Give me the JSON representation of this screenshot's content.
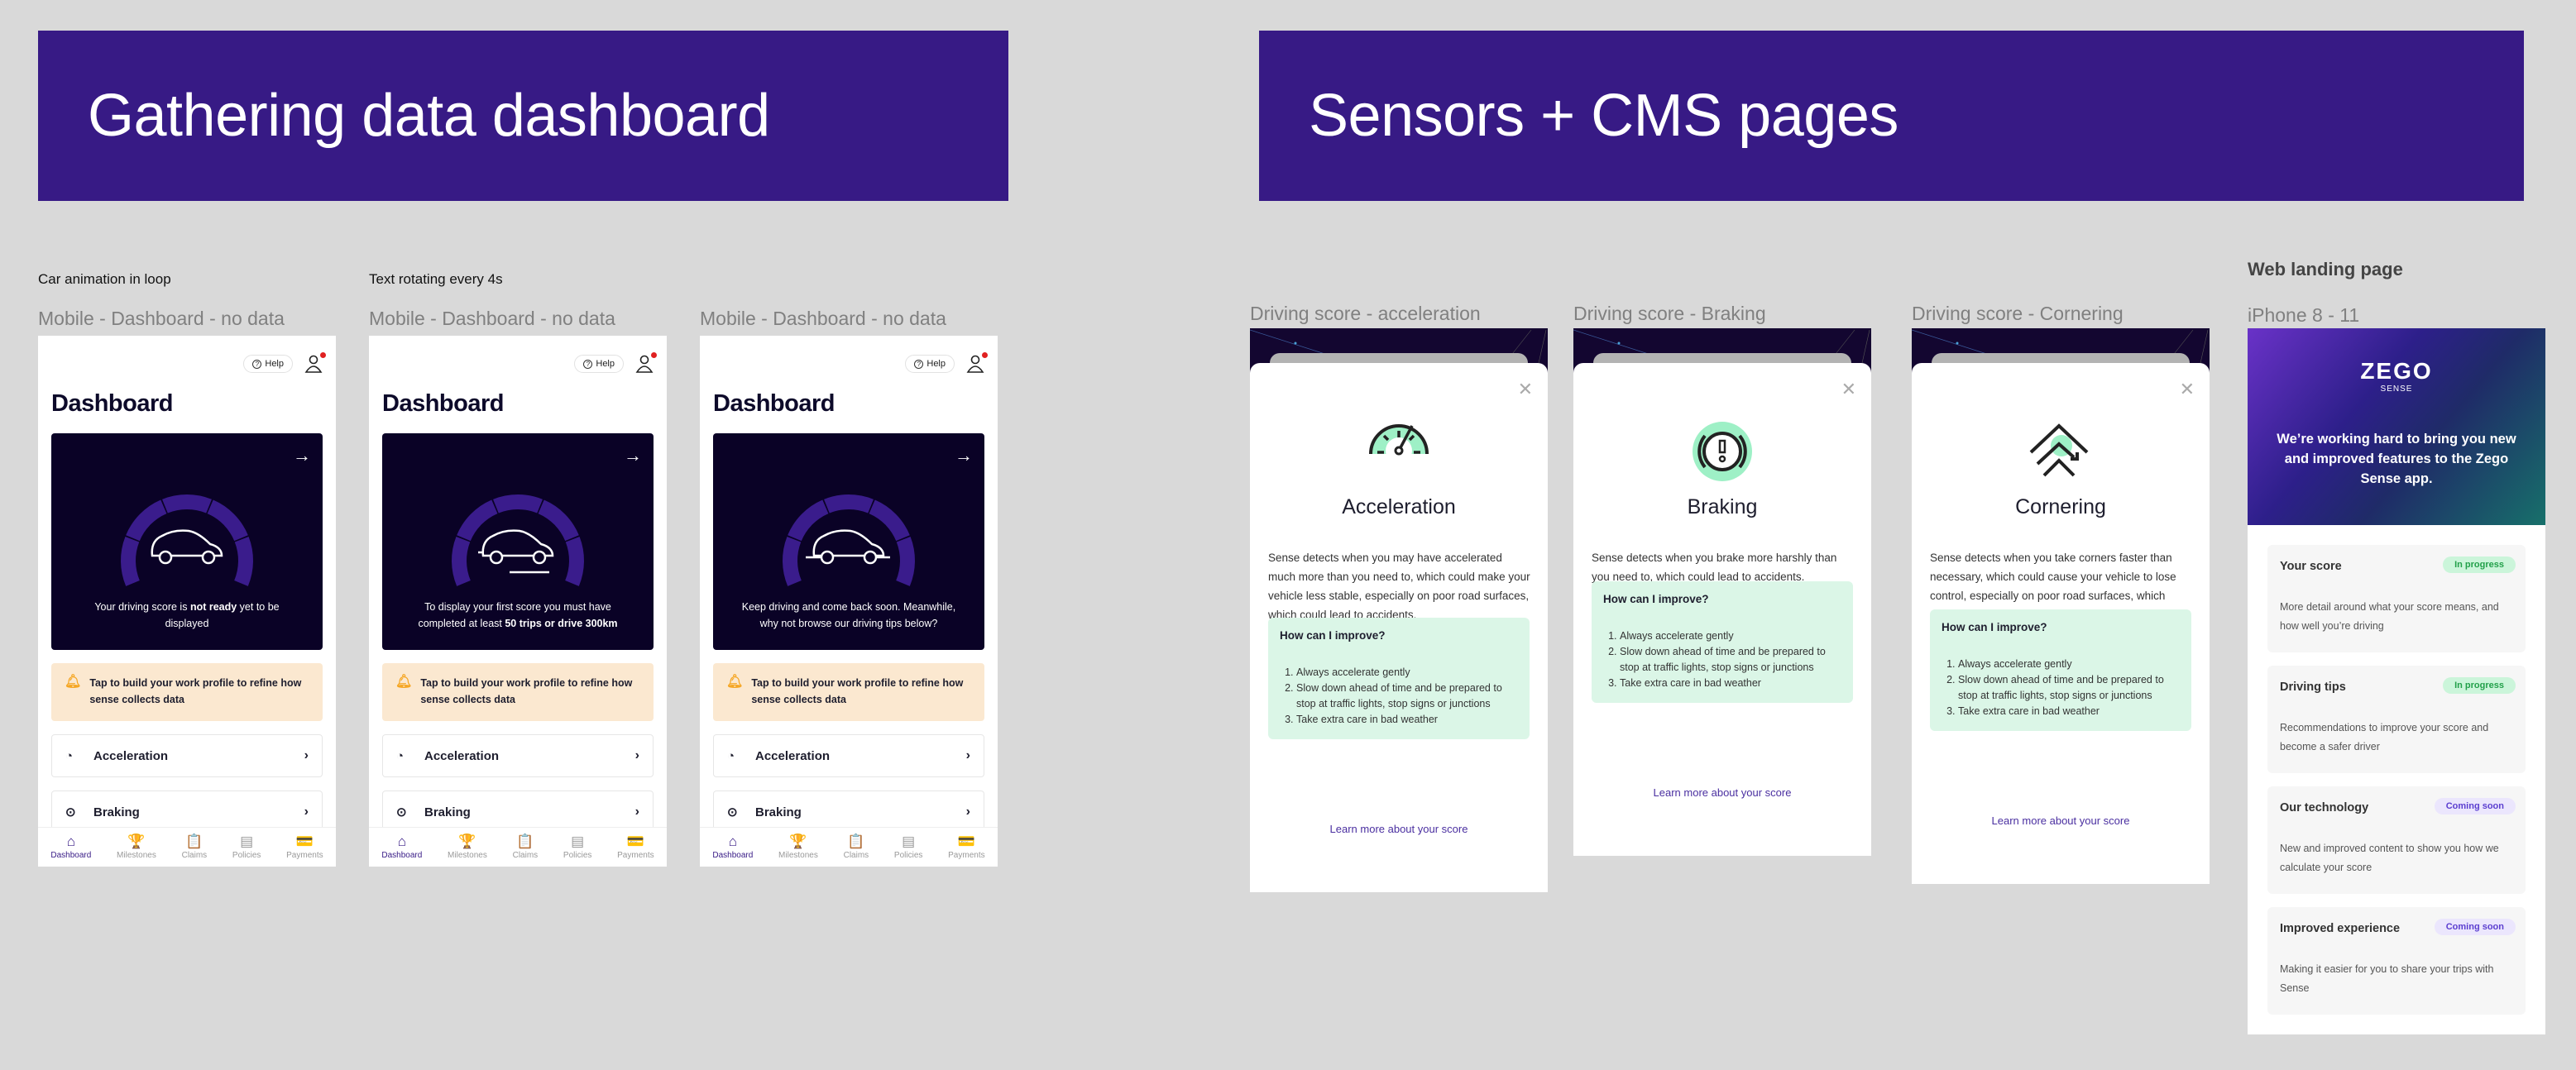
{
  "banners": {
    "left": "Gathering data dashboard",
    "right": "Sensors + CMS pages"
  },
  "notes": {
    "car_animation": "Car animation in loop",
    "text_rotating": "Text rotating every 4s",
    "web_landing": "Web landing page"
  },
  "dashboard_frames": [
    {
      "frame_label": "Mobile - Dashboard - no data",
      "help": "Help",
      "title": "Dashboard",
      "score_msg_pre": "Your driving score is ",
      "score_msg_bold": "not ready",
      "score_msg_post": " yet to be displayed",
      "car_variant": "static"
    },
    {
      "frame_label": "Mobile - Dashboard - no data",
      "help": "Help",
      "title": "Dashboard",
      "score_msg_pre": "To display your first score you must have completed at least ",
      "score_msg_bold": "50 trips or drive 300km",
      "score_msg_post": "",
      "car_variant": "moving"
    },
    {
      "frame_label": "Mobile - Dashboard - no data",
      "help": "Help",
      "title": "Dashboard",
      "score_msg_pre": "Keep driving and come back soon. Meanwhile, why not browse our driving tips below?",
      "score_msg_bold": "",
      "score_msg_post": "",
      "car_variant": "ground"
    }
  ],
  "dashboard_common": {
    "alert": "Tap to build your work profile to refine how sense collects data",
    "rows": [
      "Acceleration",
      "Braking"
    ],
    "tabs": [
      "Dashboard",
      "Milestones",
      "Claims",
      "Policies",
      "Payments"
    ],
    "active_tab": "Dashboard"
  },
  "modals": [
    {
      "frame_label": "Driving score - acceleration",
      "title": "Acceleration",
      "icon": "speedometer-icon",
      "description": "Sense detects when you may have accelerated much more than you need to, which could make your vehicle less stable, especially on poor road surfaces, which could lead to accidents.",
      "improve_title": "How can I improve?",
      "tips": [
        "Always accelerate gently",
        "Slow down ahead of time and be prepared to stop at traffic lights, stop signs or junctions",
        "Take extra care in bad weather"
      ],
      "learn_more": "Learn more about your score"
    },
    {
      "frame_label": "Driving score - Braking",
      "title": "Braking",
      "icon": "brake-warning-icon",
      "description": "Sense detects when you brake more harshly than you need to, which could lead to accidents.",
      "improve_title": "How can I improve?",
      "tips": [
        "Always accelerate gently",
        "Slow down ahead of time and be prepared to stop at traffic lights, stop signs or junctions",
        "Take extra care in bad weather"
      ],
      "learn_more": "Learn more about your score"
    },
    {
      "frame_label": "Driving score - Cornering",
      "title": "Cornering",
      "icon": "cornering-icon",
      "description": "Sense detects when you take corners faster than necessary, which could cause your vehicle to lose control, especially on poor road surfaces, which could lead to accidents.",
      "improve_title": "How can I improve?",
      "tips": [
        "Always accelerate gently",
        "Slow down ahead of time and be prepared to stop at traffic lights, stop signs or junctions",
        "Take extra care in bad weather"
      ],
      "learn_more": "Learn more about your score"
    }
  ],
  "landing": {
    "frame_label": "iPhone 8 - 11",
    "logo_word": "ZEGO",
    "logo_sub": "SENSE",
    "tagline": "We’re working hard to bring you new and improved features to the Zego Sense app.",
    "features": [
      {
        "title": "Your score",
        "badge": "In progress",
        "status": "progress",
        "desc": "More detail around what your score means, and how well you’re driving"
      },
      {
        "title": "Driving tips",
        "badge": "In progress",
        "status": "progress",
        "desc": "Recommendations to improve your score and become a safer driver"
      },
      {
        "title": "Our technology",
        "badge": "Coming soon",
        "status": "soon",
        "desc": "New and improved content to show you how we calculate your score"
      },
      {
        "title": "Improved experience",
        "badge": "Coming soon",
        "status": "soon",
        "desc": "Making it easier for you to share your trips with Sense"
      }
    ]
  },
  "colors": {
    "brand_purple": "#371a85",
    "card_dark": "#0a0226",
    "gauge_purple": "#3a1c8c",
    "alert_bg": "#fbe8d0",
    "improve_bg": "#dbf6e7",
    "accent_green": "#9ef0c6",
    "progress_green": "#22a04a",
    "soon_purple": "#5b3ed0"
  }
}
